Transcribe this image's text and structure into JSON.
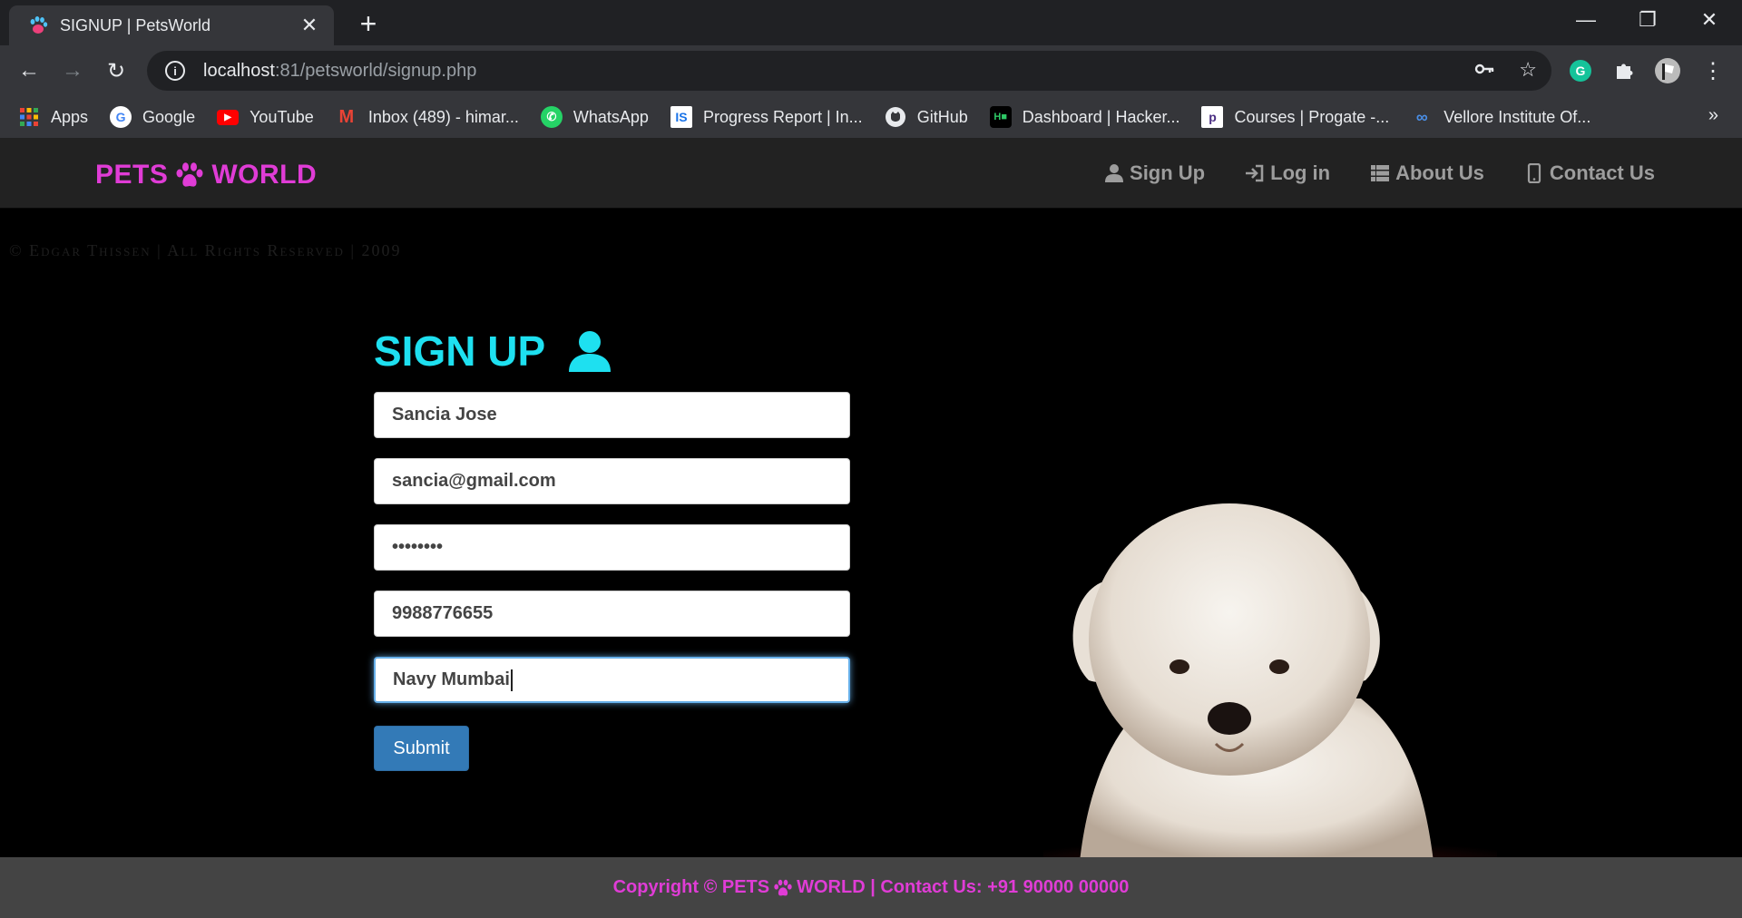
{
  "browser": {
    "tab_title": "SIGNUP | PetsWorld",
    "url_host": "localhost",
    "url_path": ":81/petsworld/signup.php",
    "bookmarks": [
      {
        "label": "Apps",
        "icon": "apps-grid-icon"
      },
      {
        "label": "Google",
        "icon": "google-icon"
      },
      {
        "label": "YouTube",
        "icon": "youtube-icon"
      },
      {
        "label": "Inbox (489) - himar...",
        "icon": "gmail-icon"
      },
      {
        "label": "WhatsApp",
        "icon": "whatsapp-icon"
      },
      {
        "label": "Progress Report | In...",
        "icon": "is-icon"
      },
      {
        "label": "GitHub",
        "icon": "github-icon"
      },
      {
        "label": "Dashboard | Hacker...",
        "icon": "hackerrank-icon"
      },
      {
        "label": "Courses | Progate -...",
        "icon": "progate-icon"
      },
      {
        "label": "Vellore Institute Of...",
        "icon": "vit-icon"
      }
    ]
  },
  "site": {
    "brand_left": "PETS",
    "brand_right": "WORLD",
    "nav": [
      {
        "label": "Sign Up",
        "icon": "user-icon"
      },
      {
        "label": "Log in",
        "icon": "login-icon"
      },
      {
        "label": "About Us",
        "icon": "list-icon"
      },
      {
        "label": "Contact Us",
        "icon": "mobile-icon"
      }
    ],
    "watermark": "© Edgar Thissen | All Rights Reserved | 2009"
  },
  "form": {
    "title": "SIGN UP",
    "name_value": "Sancia Jose",
    "email_value": "sancia@gmail.com",
    "password_value": "••••••••",
    "phone_value": "9988776655",
    "city_value": "Navy Mumbai",
    "submit_label": "Submit"
  },
  "footer": {
    "text_before": "Copyright © PETS",
    "text_after": "WORLD | Contact Us: +91 90000 00000"
  },
  "colors": {
    "brand": "#e03cd6",
    "signup_title": "#1ee0f0",
    "submit_button": "#337ab7"
  }
}
